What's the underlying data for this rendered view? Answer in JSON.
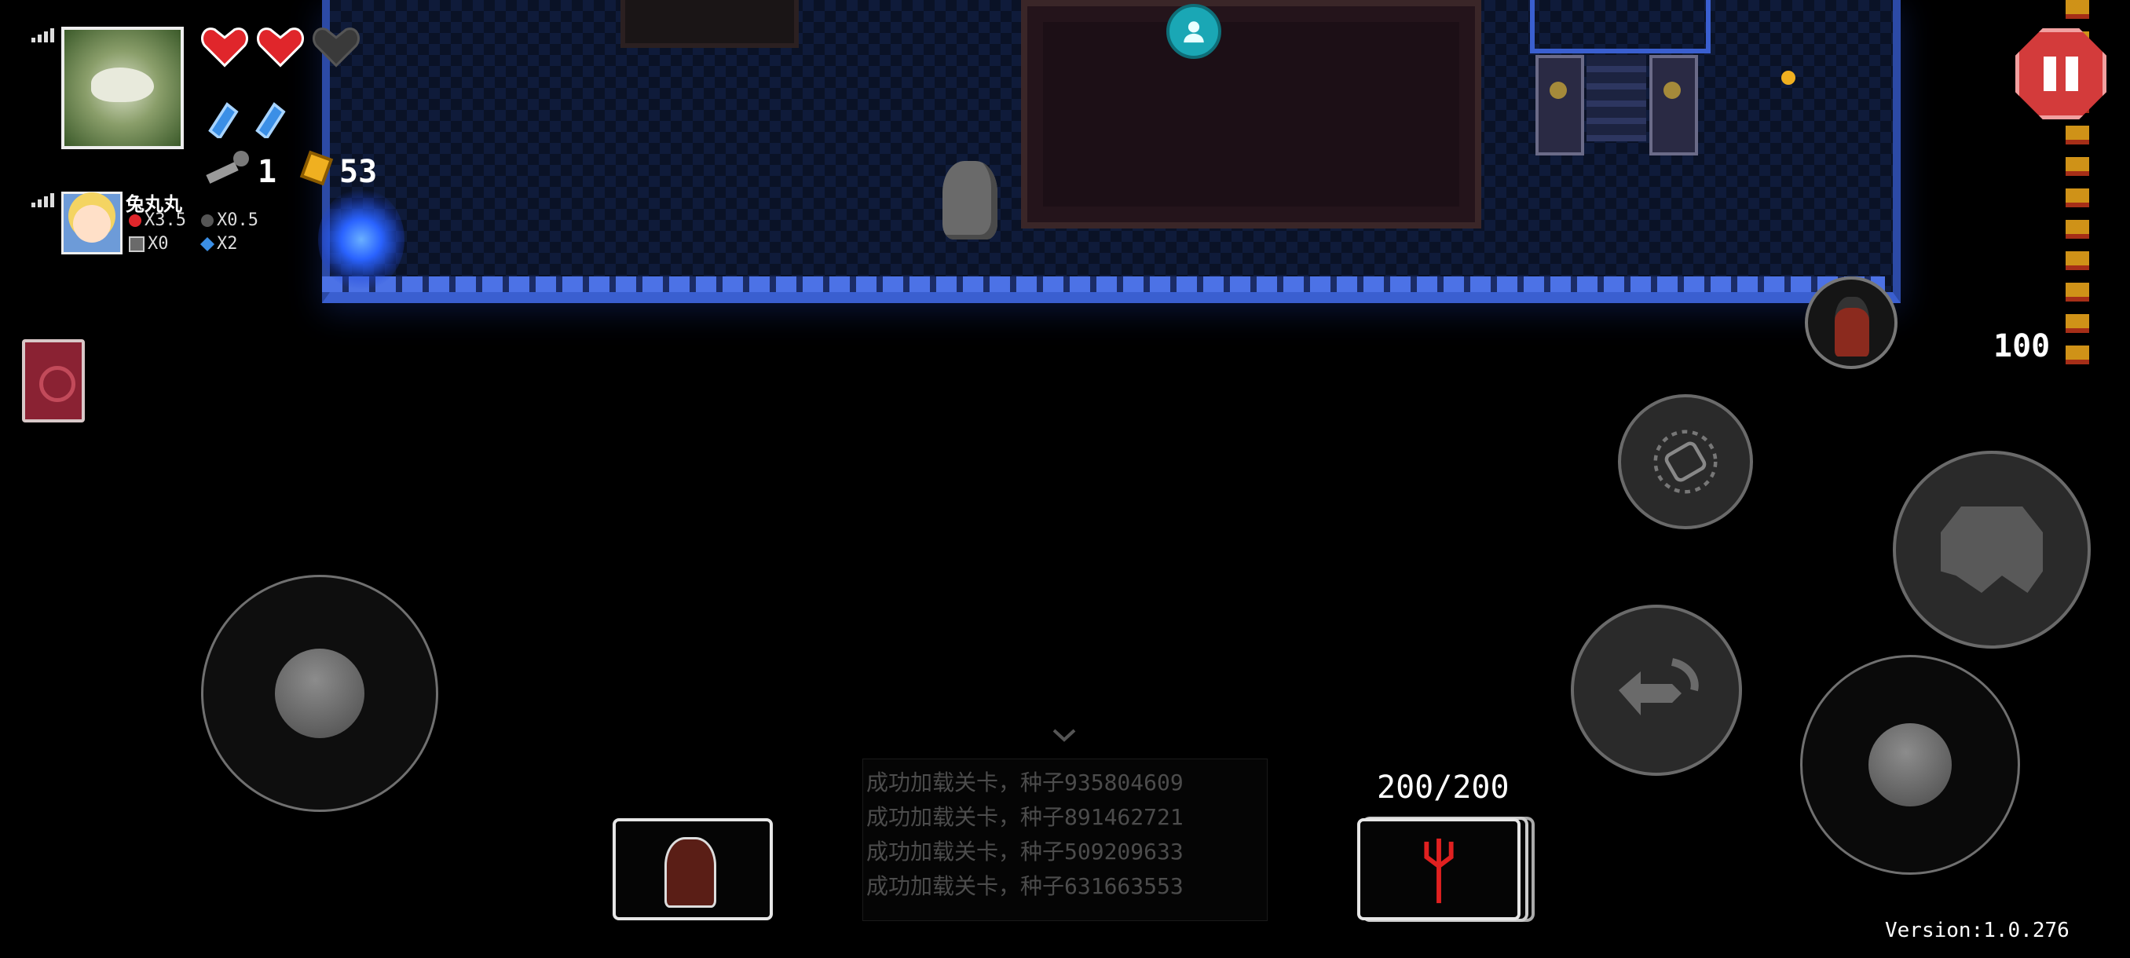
{
  "hud": {
    "p1": {
      "hearts": [
        "full",
        "full",
        "empty"
      ],
      "shields": 2,
      "keys": "1",
      "money": "53"
    },
    "p2": {
      "name": "兔丸丸",
      "health_mult": "X3.5",
      "damage_mult": "X0.5",
      "armor": "X0",
      "energy": "X2"
    }
  },
  "right_hud": {
    "ammo_reserve": "100"
  },
  "weapon": {
    "ammo": "200/200"
  },
  "log": {
    "lines": [
      "成功加载关卡，种子935804609",
      "成功加载关卡，种子891462721",
      "成功加载关卡，种子509209633",
      "成功加载关卡，种子631663553"
    ]
  },
  "footer": {
    "version": "Version:1.0.276"
  },
  "colors": {
    "heart": "#e0262b",
    "shield": "#3b8fe6",
    "money": "#f0b020",
    "pause": "#d33b3b",
    "wall": "#3a5fd0"
  }
}
